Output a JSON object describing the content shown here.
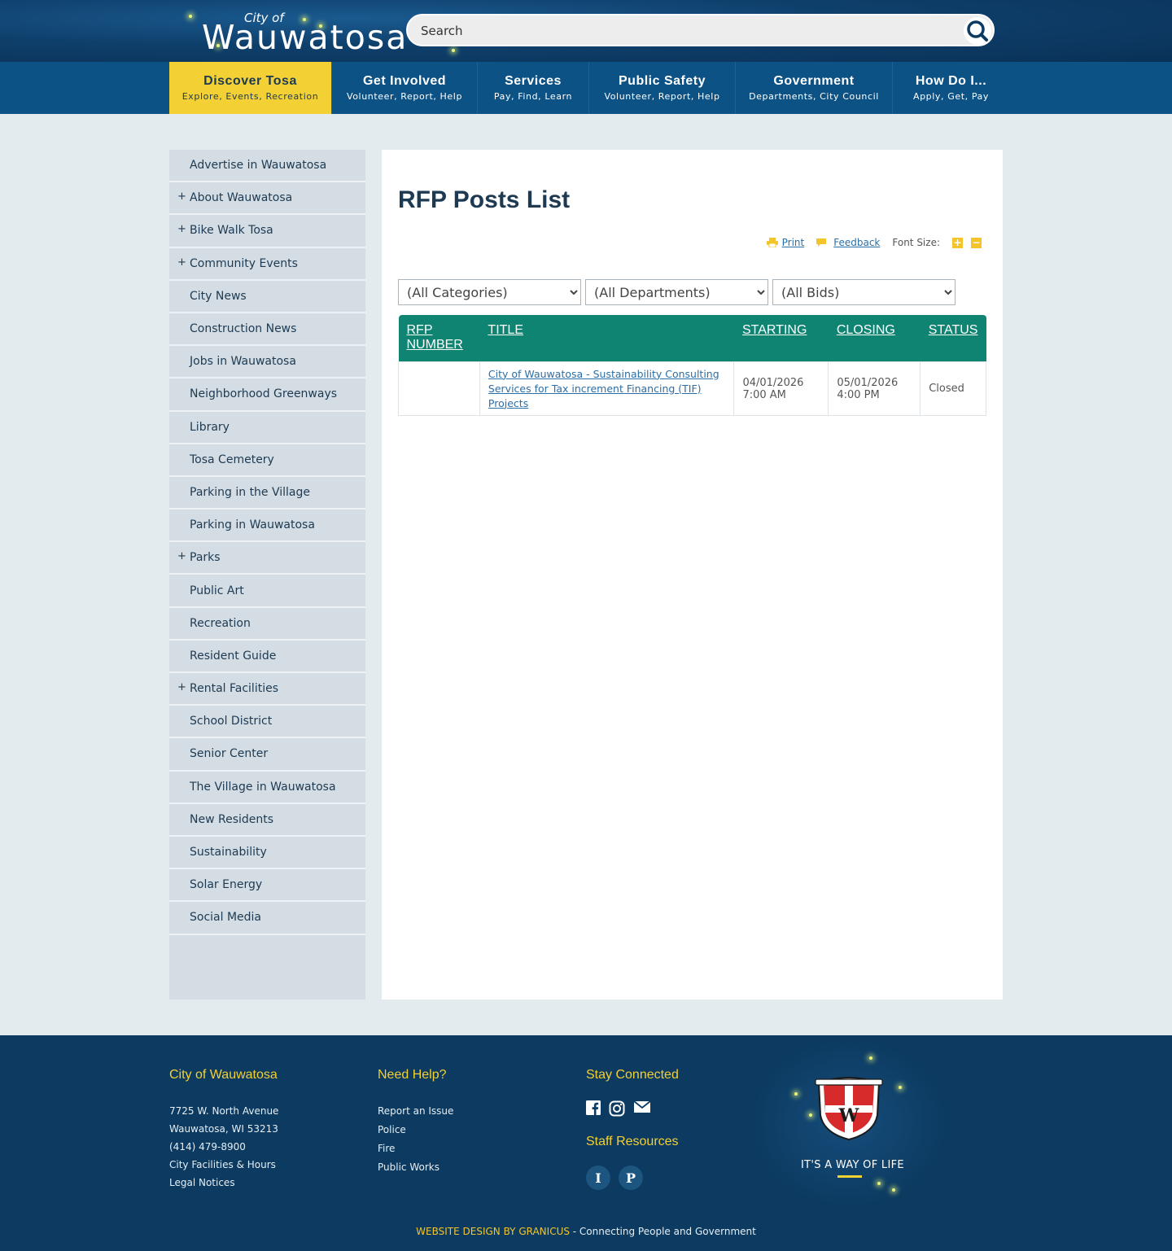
{
  "header": {
    "logo_small": "City of",
    "logo_name": "Wauwatosa",
    "search_placeholder": "Search"
  },
  "nav": [
    {
      "title": "Discover Tosa",
      "sub": "Explore, Events, Recreation",
      "width": 200
    },
    {
      "title": "Get Involved",
      "sub": "Volunteer, Report, Help",
      "width": 179
    },
    {
      "title": "Services",
      "sub": "Pay, Find, Learn",
      "width": 137
    },
    {
      "title": "Public Safety",
      "sub": "Volunteer, Report, Help",
      "width": 180
    },
    {
      "title": "Government",
      "sub": "Departments, City Council",
      "width": 193
    },
    {
      "title": "How Do I...",
      "sub": "Apply, Get, Pay",
      "width": 143
    }
  ],
  "sidebar": {
    "items": [
      {
        "label": "Advertise in Wauwatosa",
        "expandable": false
      },
      {
        "label": "About Wauwatosa",
        "expandable": true
      },
      {
        "label": "Bike Walk Tosa",
        "expandable": true
      },
      {
        "label": "Community Events",
        "expandable": true
      },
      {
        "label": "City News",
        "expandable": false
      },
      {
        "label": "Construction News",
        "expandable": false
      },
      {
        "label": "Jobs in Wauwatosa",
        "expandable": false
      },
      {
        "label": "Neighborhood Greenways",
        "expandable": false
      },
      {
        "label": "Library",
        "expandable": false
      },
      {
        "label": "Tosa Cemetery",
        "expandable": false
      },
      {
        "label": "Parking in the Village",
        "expandable": false
      },
      {
        "label": "Parking in Wauwatosa",
        "expandable": false
      },
      {
        "label": "Parks",
        "expandable": true
      },
      {
        "label": "Public Art",
        "expandable": false
      },
      {
        "label": "Recreation",
        "expandable": false
      },
      {
        "label": "Resident Guide",
        "expandable": false
      },
      {
        "label": "Rental Facilities",
        "expandable": true
      },
      {
        "label": "School District",
        "expandable": false
      },
      {
        "label": "Senior Center",
        "expandable": false
      },
      {
        "label": "The Village in Wauwatosa",
        "expandable": false
      },
      {
        "label": "New Residents",
        "expandable": false
      },
      {
        "label": "Sustainability",
        "expandable": false
      },
      {
        "label": "Solar Energy",
        "expandable": false
      },
      {
        "label": "Social Media",
        "expandable": false
      }
    ]
  },
  "main": {
    "title": "RFP Posts List",
    "tools": {
      "print": "Print",
      "feedback": "Feedback",
      "font_size": "Font Size:"
    },
    "filters": {
      "categories": "(All Categories)",
      "departments": "(All Departments)",
      "bids": "(All Bids)"
    },
    "table": {
      "headers": {
        "number_1": "RFP",
        "number_2": "NUMBER",
        "title": "TITLE",
        "starting": "STARTING",
        "closing": "CLOSING",
        "status": "STATUS"
      },
      "rows": [
        {
          "number": "",
          "title": "City of Wauwatosa - Sustainability Consulting Services for Tax increment Financing (TIF) Projects",
          "start_date": "04/01/2026",
          "start_time": "7:00 AM",
          "close_date": "05/01/2026",
          "close_time": "4:00 PM",
          "status": "Closed"
        }
      ]
    }
  },
  "footer": {
    "city": {
      "heading": "City of Wauwatosa",
      "lines": [
        "7725 W. North Avenue",
        "Wauwatosa, WI 53213",
        "(414) 479-8900",
        "City Facilities & Hours",
        "Legal Notices"
      ]
    },
    "help": {
      "heading": "Need Help?",
      "links": [
        "Report an Issue",
        "Police",
        "Fire",
        "Public Works"
      ]
    },
    "connected": {
      "heading": "Stay Connected",
      "staff_heading": "Staff Resources",
      "staff_buttons": [
        "I",
        "P"
      ]
    },
    "tagline": "IT'S A WAY OF LIFE",
    "credit_link": "WEBSITE DESIGN BY GRANICUS",
    "credit_text": " - Connecting People and Government"
  },
  "colors": {
    "nav_bg": "#0d5285",
    "active_nav": "#f3d033",
    "table_header": "#0f8473",
    "footer_bg": "#0c3a60",
    "accent_yellow": "#f3d033"
  }
}
